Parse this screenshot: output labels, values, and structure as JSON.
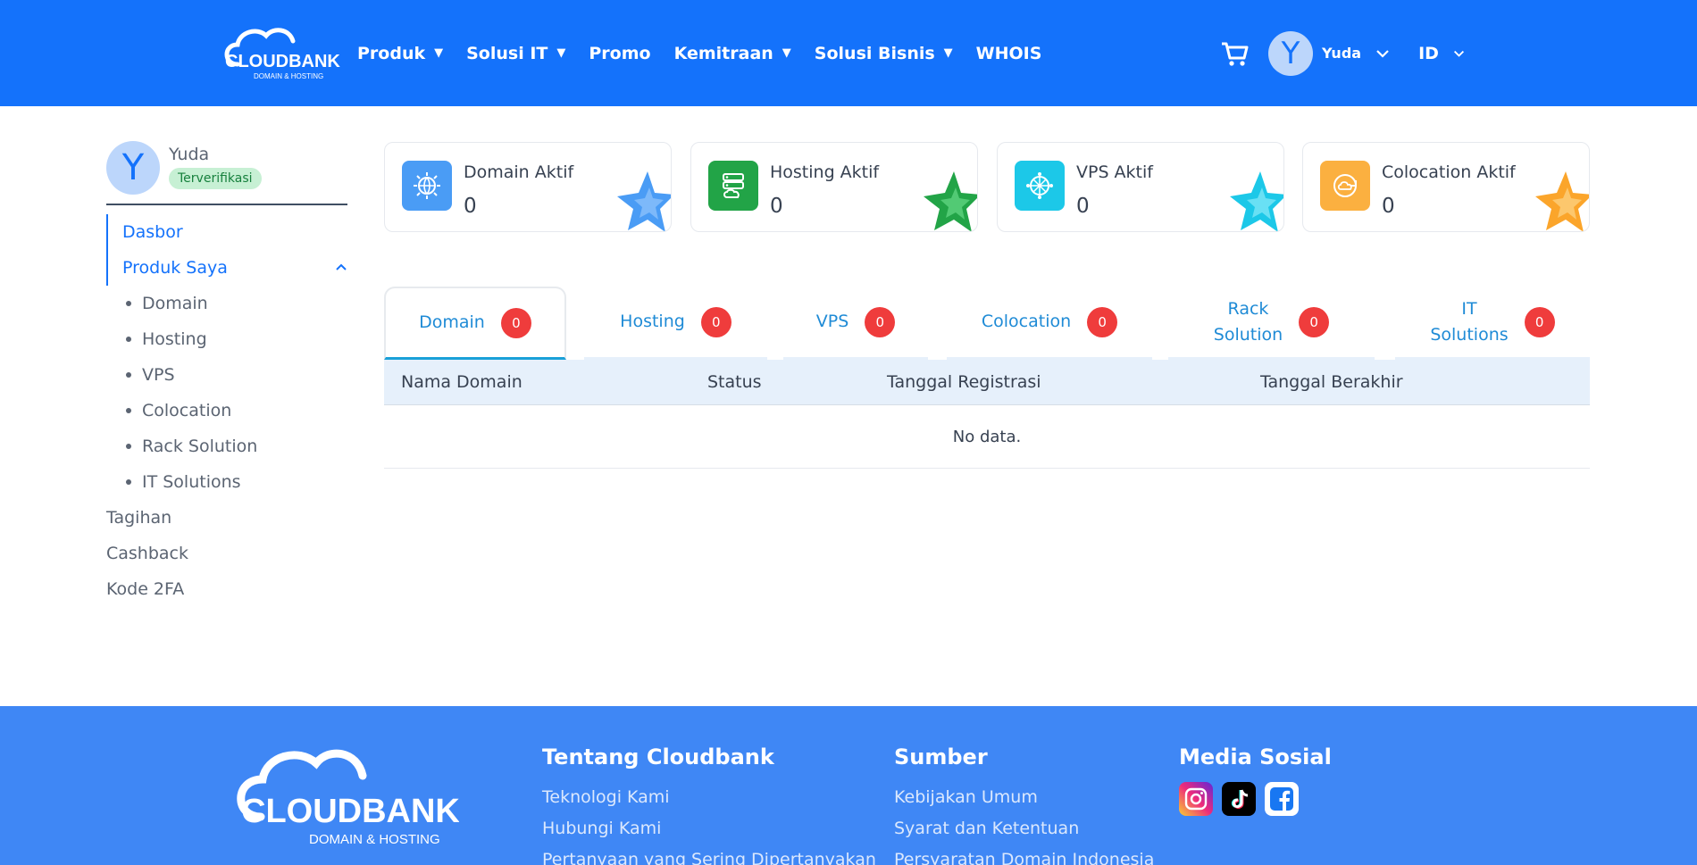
{
  "brand": {
    "name": "CLOUDBANK",
    "tagline": "DOMAIN & HOSTING"
  },
  "header": {
    "nav": [
      {
        "label": "Produk",
        "has_dropdown": true
      },
      {
        "label": "Solusi IT",
        "has_dropdown": true
      },
      {
        "label": "Promo",
        "has_dropdown": false
      },
      {
        "label": "Kemitraan",
        "has_dropdown": true
      },
      {
        "label": "Solusi Bisnis",
        "has_dropdown": true
      },
      {
        "label": "WHOIS",
        "has_dropdown": false
      }
    ],
    "cart_icon": "cart-icon",
    "user": {
      "initial": "Y",
      "name": "Yuda"
    },
    "language": "ID"
  },
  "sidebar": {
    "profile": {
      "initial": "Y",
      "name": "Yuda",
      "status": "Terverifikasi"
    },
    "menu": {
      "dashboard": "Dasbor",
      "my_products": "Produk Saya",
      "sub_items": [
        "Domain",
        "Hosting",
        "VPS",
        "Colocation",
        "Rack Solution",
        "IT Solutions"
      ],
      "billing": "Tagihan",
      "cashback": "Cashback",
      "twofa": "Kode 2FA"
    }
  },
  "stats": [
    {
      "title": "Domain Aktif",
      "value": "0",
      "icon": "globe-icon",
      "color": "#4a9cf5"
    },
    {
      "title": "Hosting Aktif",
      "value": "0",
      "icon": "server-icon",
      "color": "#22a447"
    },
    {
      "title": "VPS Aktif",
      "value": "0",
      "icon": "network-icon",
      "color": "#1cc8e8"
    },
    {
      "title": "Colocation Aktif",
      "value": "0",
      "icon": "cloud-sync-icon",
      "color": "#fbb040"
    }
  ],
  "tabs": [
    {
      "label": "Domain",
      "count": "0",
      "active": true
    },
    {
      "label": "Hosting",
      "count": "0",
      "active": false
    },
    {
      "label": "VPS",
      "count": "0",
      "active": false
    },
    {
      "label": "Colocation",
      "count": "0",
      "active": false
    },
    {
      "label_line1": "Rack",
      "label_line2": "Solution",
      "count": "0",
      "active": false
    },
    {
      "label_line1": "IT",
      "label_line2": "Solutions",
      "count": "0",
      "active": false
    }
  ],
  "table": {
    "columns": [
      "Nama Domain",
      "Status",
      "Tanggal Registrasi",
      "Tanggal Berakhir"
    ],
    "empty_text": "No data."
  },
  "footer": {
    "about": {
      "title": "Tentang Cloudbank",
      "links": [
        "Teknologi Kami",
        "Hubungi Kami",
        "Pertanyaan yang Sering Dipertanyakan"
      ]
    },
    "resources": {
      "title": "Sumber",
      "links": [
        "Kebijakan Umum",
        "Syarat dan Ketentuan",
        "Persyaratan Domain Indonesia"
      ]
    },
    "social": {
      "title": "Media Sosial",
      "icons": [
        "instagram-icon",
        "tiktok-icon",
        "facebook-icon"
      ]
    }
  }
}
